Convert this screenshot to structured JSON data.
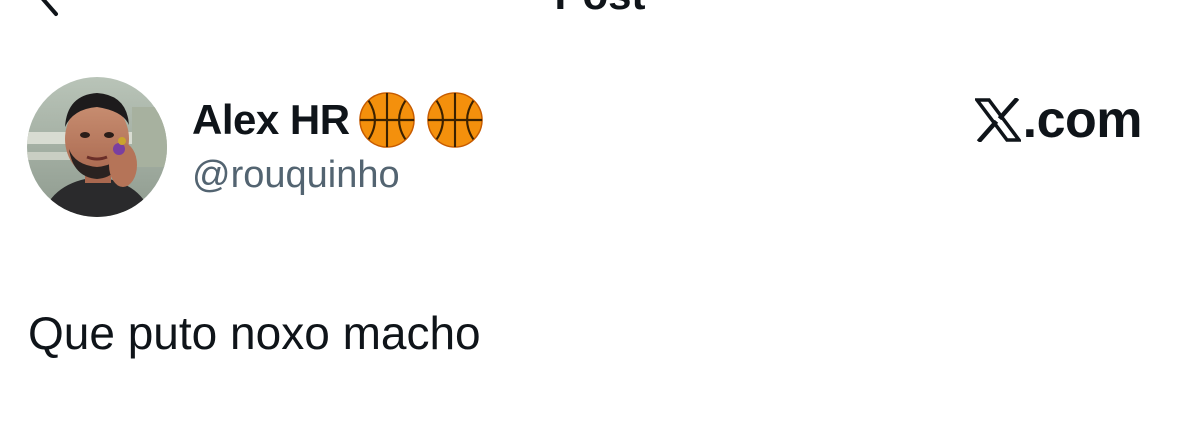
{
  "header": {
    "title": "Post",
    "back_icon": "chevron-left-icon"
  },
  "author": {
    "display_name": "Alex HR",
    "name_emojis": [
      "basketball-emoji",
      "basketball-emoji"
    ],
    "handle": "@rouquinho",
    "avatar": "profile-photo"
  },
  "brand": {
    "label": ".com",
    "logo_icon": "x-logo-icon"
  },
  "post": {
    "text": "Que puto noxo macho"
  },
  "colors": {
    "text_primary": "#0f1419",
    "text_secondary": "#536471",
    "background": "#ffffff"
  }
}
